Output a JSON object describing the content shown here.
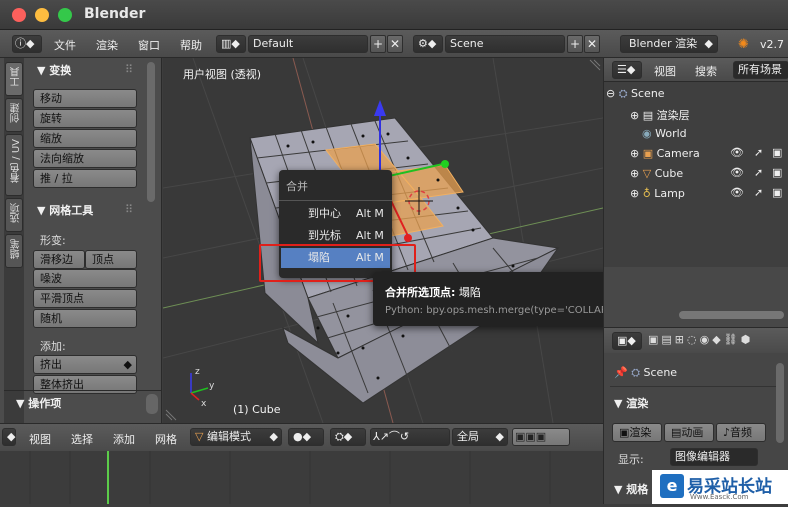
{
  "window": {
    "title": "Blender"
  },
  "topbar": {
    "menus": [
      "文件",
      "渲染",
      "窗口",
      "帮助"
    ],
    "layout": "Default",
    "scene": "Scene",
    "engine": "Blender 渲染",
    "version": "v2.7"
  },
  "tool_panel": {
    "tabs": [
      "工具",
      "创建",
      "着色 / UV",
      "选项",
      "蜡笔"
    ],
    "transform": {
      "title": "变换",
      "buttons": [
        "移动",
        "旋转",
        "缩放",
        "法向缩放",
        "推 / 拉"
      ]
    },
    "mesh_tools": {
      "title": "网格工具",
      "deform_label": "形变:",
      "deform_buttons": [
        "滑移边",
        "顶点"
      ],
      "buttons": [
        "噪波",
        "平滑顶点",
        "随机"
      ],
      "add_label": "添加:",
      "extrude": "挤出",
      "extrude_all": "整体挤出"
    },
    "operator": {
      "title": "操作项"
    }
  },
  "viewport": {
    "title": "用户视图 (透视)",
    "object": "(1) Cube"
  },
  "merge_menu": {
    "title": "合并",
    "items": [
      {
        "label": "到中心",
        "key": "Alt M"
      },
      {
        "label": "到光标",
        "key": "Alt M"
      },
      {
        "label": "塌陷",
        "key": "Alt M"
      }
    ]
  },
  "tooltip": {
    "label": "合并所选顶点:",
    "value": "塌陷",
    "python": "Python: bpy.ops.mesh.merge(type='COLLAPSE')"
  },
  "outliner": {
    "menus": [
      "视图",
      "搜索"
    ],
    "filter": "所有场景",
    "items": [
      "Scene",
      "渲染层",
      "World",
      "Camera",
      "Cube",
      "Lamp"
    ]
  },
  "properties": {
    "scene": "Scene",
    "render_title": "渲染",
    "buttons": [
      "渲染",
      "动画",
      "音频"
    ],
    "display_label": "显示:",
    "display_value": "图像编辑器",
    "size_title": "规格"
  },
  "bottombar": {
    "menus": [
      "视图",
      "选择",
      "添加",
      "网格"
    ],
    "mode": "编辑模式",
    "pivot": "全局"
  },
  "watermark": {
    "text": "易采站长站",
    "sub": "Www.Easck.Com"
  },
  "colors": {
    "accent": "#5680c2",
    "highlight": "#e0201a",
    "selected_face": "#e8a050"
  }
}
